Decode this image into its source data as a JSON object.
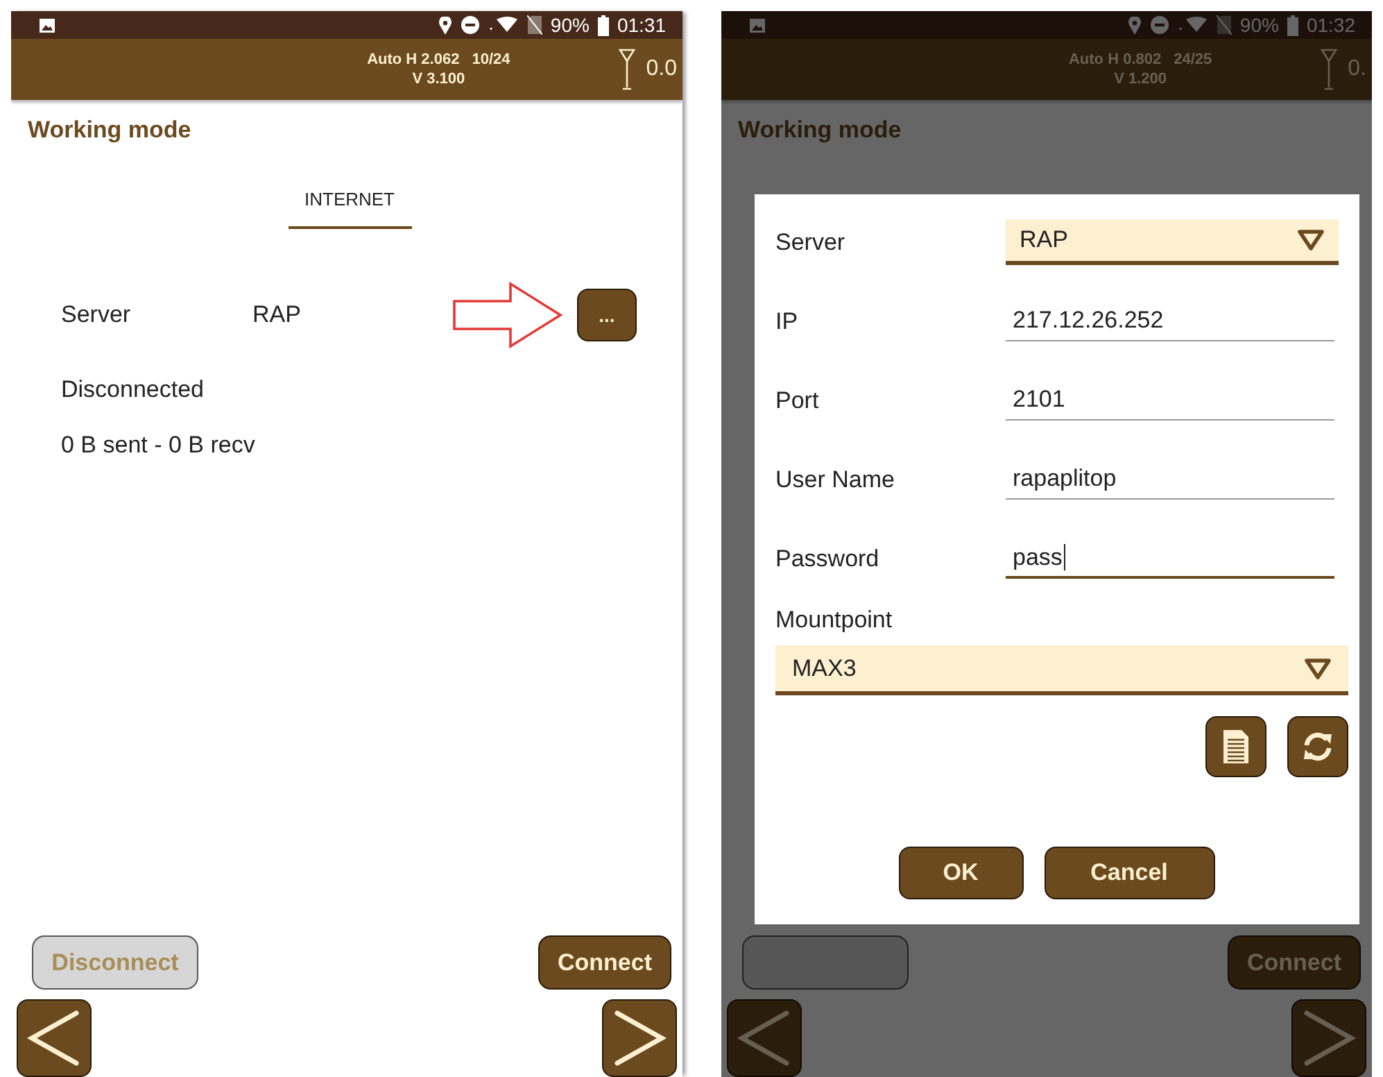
{
  "screens": [
    {
      "status_bar": {
        "battery": "90%",
        "time": "01:31"
      },
      "header": {
        "h_reading": "Auto H 2.062",
        "sats": "10/24",
        "v_reading": "V 3.100",
        "reading": "0.0"
      },
      "title": "Working mode",
      "tabs": [
        {
          "label": "INTERNET",
          "selected": true
        }
      ],
      "server": {
        "label": "Server",
        "value": "RAP",
        "more_button": "..."
      },
      "status": "Disconnected",
      "traffic": "0 B sent - 0 B recv",
      "callout_arrow": true,
      "buttons": [
        {
          "label": "Disconnect",
          "disabled": true
        },
        {
          "label": "Connect",
          "disabled": false
        }
      ],
      "dimmed": false
    },
    {
      "status_bar": {
        "battery": "90%",
        "time": "01:32"
      },
      "header": {
        "h_reading": "Auto H 0.802",
        "sats": "24/25",
        "v_reading": "V 1.200",
        "reading": "0."
      },
      "title": "Working mode",
      "buttons": [
        {
          "disabled": true
        },
        {
          "label": "Connect",
          "disabled": false
        }
      ],
      "dimmed": true,
      "dialog": {
        "fields": [
          {
            "kind": "dropdown",
            "label": "Server",
            "value": "RAP"
          },
          {
            "kind": "text",
            "label": "IP",
            "value": "217.12.26.252",
            "focused": false
          },
          {
            "kind": "text",
            "label": "Port",
            "value": "2101",
            "focused": false
          },
          {
            "kind": "text",
            "label": "User Name",
            "value": "rapaplitop",
            "focused": false
          },
          {
            "kind": "text",
            "label": "Password",
            "value": "pass",
            "focused": true
          }
        ],
        "mountpoint": {
          "label": "Mountpoint",
          "value": "MAX3"
        },
        "buttons": [
          "OK",
          "Cancel"
        ]
      }
    }
  ]
}
